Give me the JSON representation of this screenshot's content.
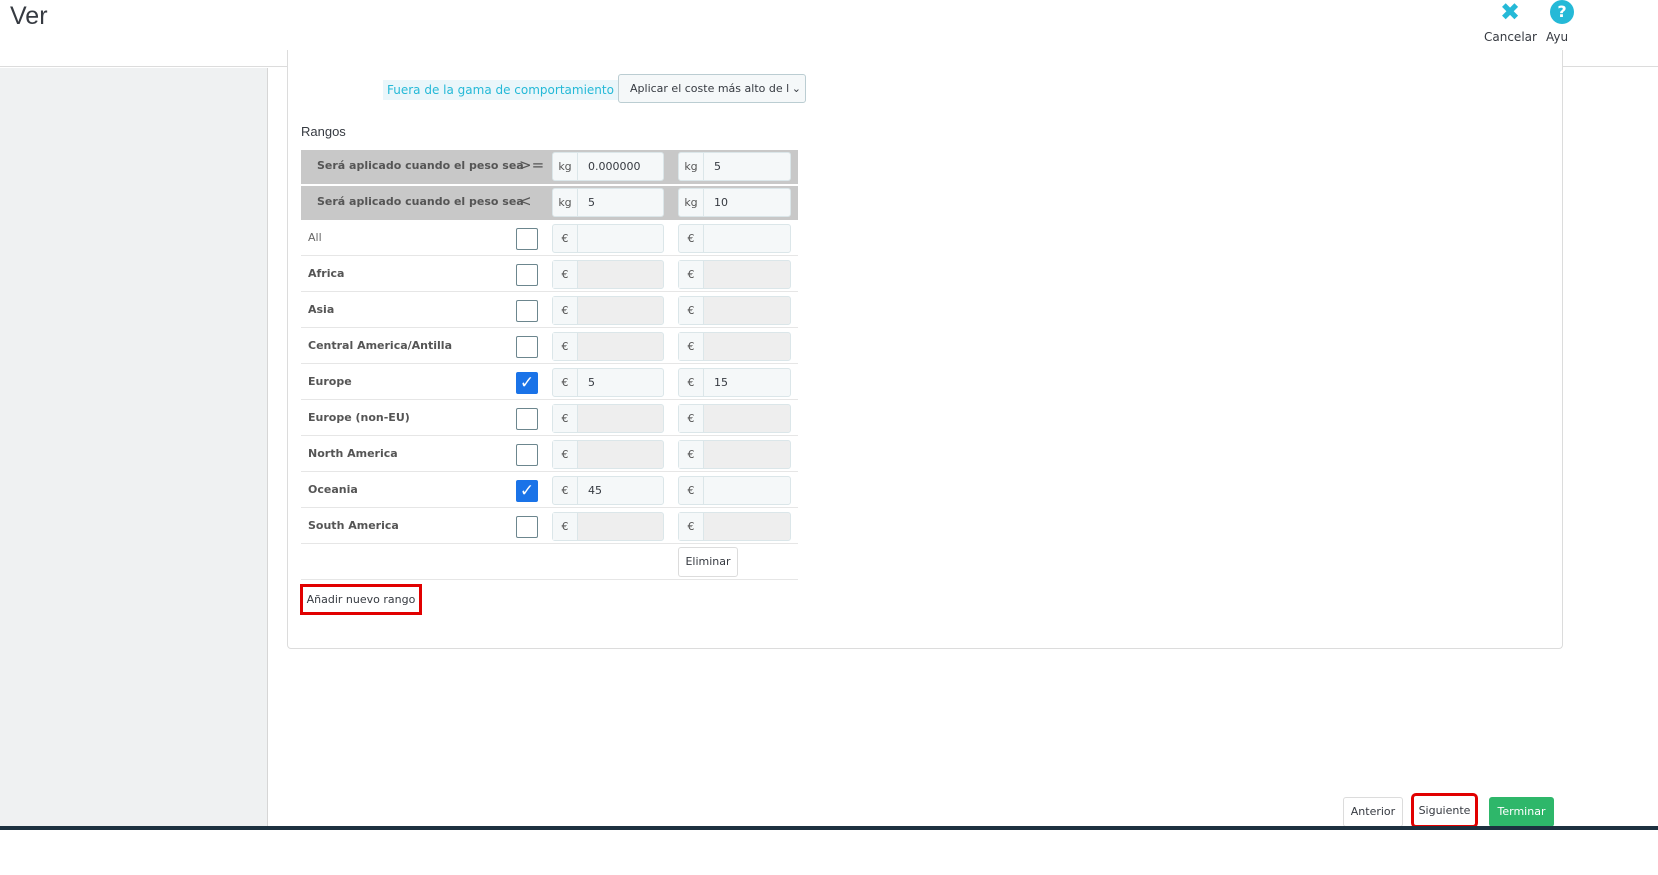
{
  "header": {
    "title": "Ver",
    "cancel_label": "Cancelar",
    "help_label": "Ayu"
  },
  "form": {
    "out_of_range_label": "Fuera de la gama de comportamiento",
    "out_of_range_value": "Aplicar el coste más alto de la",
    "ranges_title": "Rangos",
    "range_rows": [
      {
        "label": "Será aplicado cuando el peso sea",
        "operator": ">=",
        "unit": "kg",
        "from": "0.000000",
        "to": "5"
      },
      {
        "label": "Será aplicado cuando el peso sea",
        "operator": "<",
        "unit": "kg",
        "from": "5",
        "to": "10"
      }
    ],
    "currency": "€",
    "zones": [
      {
        "name": "All",
        "checked": false,
        "v1": "",
        "v2": ""
      },
      {
        "name": "Africa",
        "checked": false,
        "v1": "",
        "v2": ""
      },
      {
        "name": "Asia",
        "checked": false,
        "v1": "",
        "v2": ""
      },
      {
        "name": "Central America/Antilla",
        "checked": false,
        "v1": "",
        "v2": ""
      },
      {
        "name": "Europe",
        "checked": true,
        "v1": "5",
        "v2": "15"
      },
      {
        "name": "Europe (non-EU)",
        "checked": false,
        "v1": "",
        "v2": ""
      },
      {
        "name": "North America",
        "checked": false,
        "v1": "",
        "v2": ""
      },
      {
        "name": "Oceania",
        "checked": true,
        "v1": "45",
        "v2": ""
      },
      {
        "name": "South America",
        "checked": false,
        "v1": "",
        "v2": ""
      }
    ],
    "delete_label": "Eliminar",
    "add_range_label": "Añadir nuevo rango"
  },
  "footer": {
    "prev_label": "Anterior",
    "next_label": "Siguiente",
    "finish_label": "Terminar"
  },
  "colors": {
    "accent": "#25b9d7",
    "success": "#2eb76a",
    "highlight": "#e10000",
    "checkbox": "#1a73e8"
  }
}
